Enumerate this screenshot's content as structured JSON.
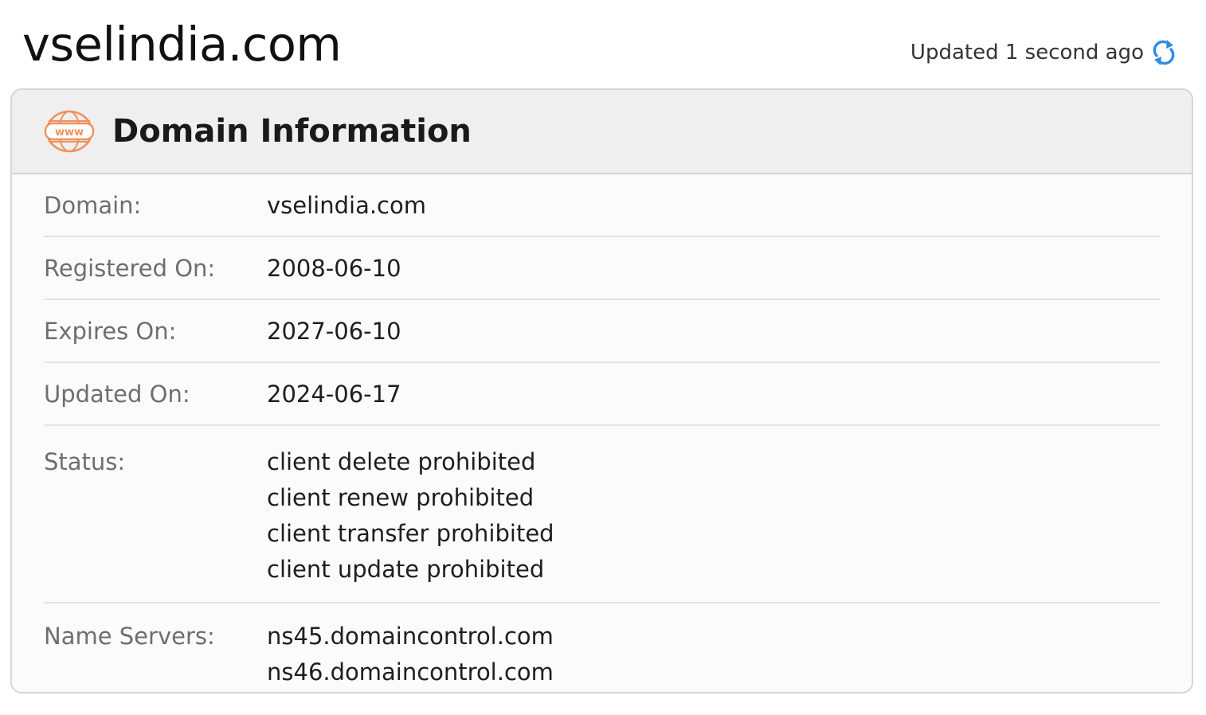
{
  "page": {
    "title": "vselindia.com",
    "updated_text": "Updated 1 second ago",
    "refresh_icon": "refresh-icon"
  },
  "card": {
    "title": "Domain Information",
    "icon": "www-icon",
    "icon_text": "www",
    "colors": {
      "icon_accent": "#f0905a",
      "refresh_accent": "#2d8ce6"
    },
    "rows": [
      {
        "label": "Domain:",
        "values": [
          "vselindia.com"
        ]
      },
      {
        "label": "Registered On:",
        "values": [
          "2008-06-10"
        ]
      },
      {
        "label": "Expires On:",
        "values": [
          "2027-06-10"
        ]
      },
      {
        "label": "Updated On:",
        "values": [
          "2024-06-17"
        ]
      },
      {
        "label": "Status:",
        "values": [
          "client delete prohibited",
          "client renew prohibited",
          "client transfer prohibited",
          "client update prohibited"
        ]
      },
      {
        "label": "Name Servers:",
        "values": [
          "ns45.domaincontrol.com",
          "ns46.domaincontrol.com"
        ]
      }
    ]
  }
}
